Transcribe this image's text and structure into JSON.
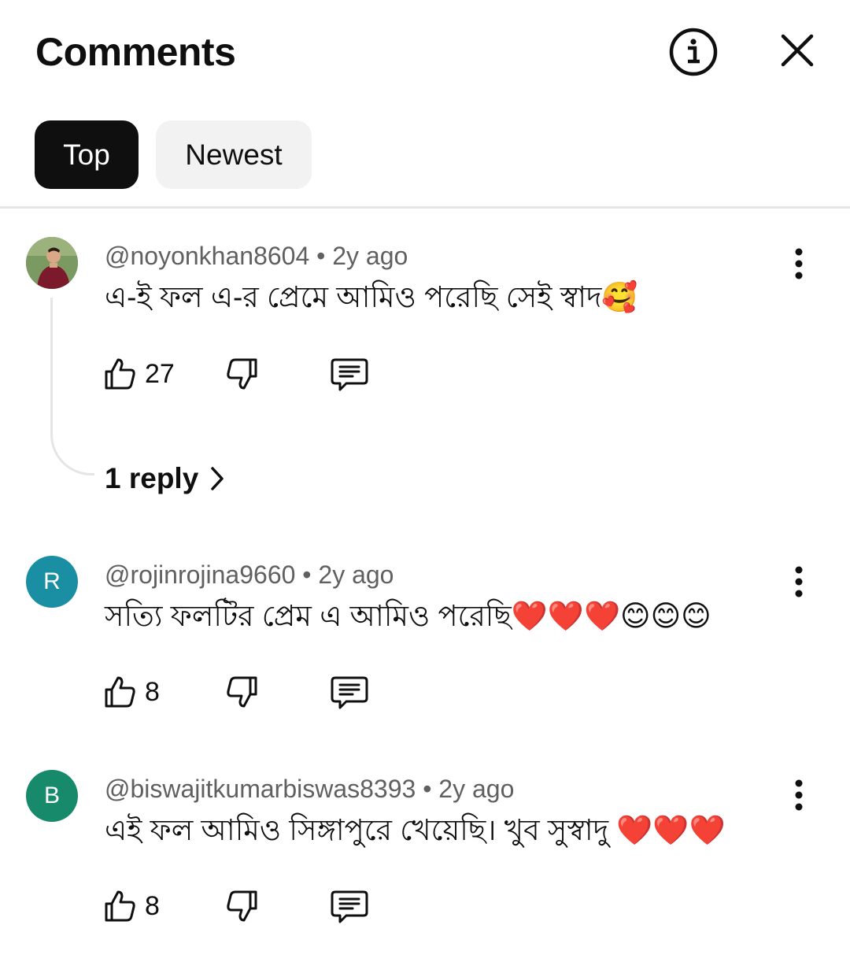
{
  "header": {
    "title": "Comments"
  },
  "tabs": [
    {
      "label": "Top",
      "selected": true
    },
    {
      "label": "Newest",
      "selected": false
    }
  ],
  "comments": [
    {
      "author": "@noyonkhan8604",
      "time": "2y ago",
      "meta": "@noyonkhan8604 • 2y ago",
      "text": "এ-ই ফল এ-র প্রেমে আমিও পরেছি সেই স্বাদ🥰",
      "likes": "27",
      "avatar": {
        "type": "photo",
        "color": "#6b8f58"
      },
      "replies_label": "1 reply"
    },
    {
      "author": "@rojinrojina9660",
      "time": "2y ago",
      "meta": "@rojinrojina9660 • 2y ago",
      "text": "সত্যি  ফলটির প্রেম এ আমিও পরেছি❤️❤️❤️😊😊😊",
      "likes": "8",
      "avatar": {
        "type": "letter",
        "letter": "R",
        "color": "#1a8fa3"
      }
    },
    {
      "author": "@biswajitkumarbiswas8393",
      "time": "2y ago",
      "meta": "@biswajitkumarbiswas8393 • 2y ago",
      "text": "এই ফল আমিও সিঙ্গাপুরে খেয়েছি। খুব সুস্বাদু ❤️❤️❤️",
      "likes": "8",
      "avatar": {
        "type": "letter",
        "letter": "B",
        "color": "#168a6a"
      }
    }
  ]
}
